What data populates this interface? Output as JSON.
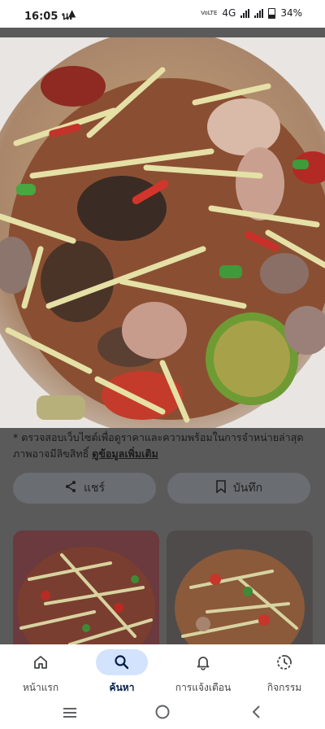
{
  "status_bar": {
    "time": "16:05 น.",
    "network_label": "4G",
    "volte_label": "VoLTE",
    "battery": "34%"
  },
  "image_viewer": {
    "image_alt": "ส้มตำปู กุ้ง และหอยแครง",
    "caption_text": "* ตรวจสอบเว็บไซต์เพื่อดูราคาและความพร้อมในการจำหน่ายล่าสุด ภาพอาจมีลิขสิทธิ์ ",
    "caption_link": "ดูข้อมูลเพิ่มเติม",
    "share_label": "แชร์",
    "save_label": "บันทึก"
  },
  "bottom_nav": {
    "items": [
      {
        "label": "หน้าแรก",
        "icon": "home-icon"
      },
      {
        "label": "ค้นหา",
        "icon": "search-icon"
      },
      {
        "label": "การแจ้งเตือน",
        "icon": "bell-icon"
      },
      {
        "label": "กิจกรรม",
        "icon": "activity-icon"
      }
    ],
    "active_index": 1
  },
  "colors": {
    "active_pill": "#d3e3fd",
    "overlay": "#5a5a5a"
  }
}
